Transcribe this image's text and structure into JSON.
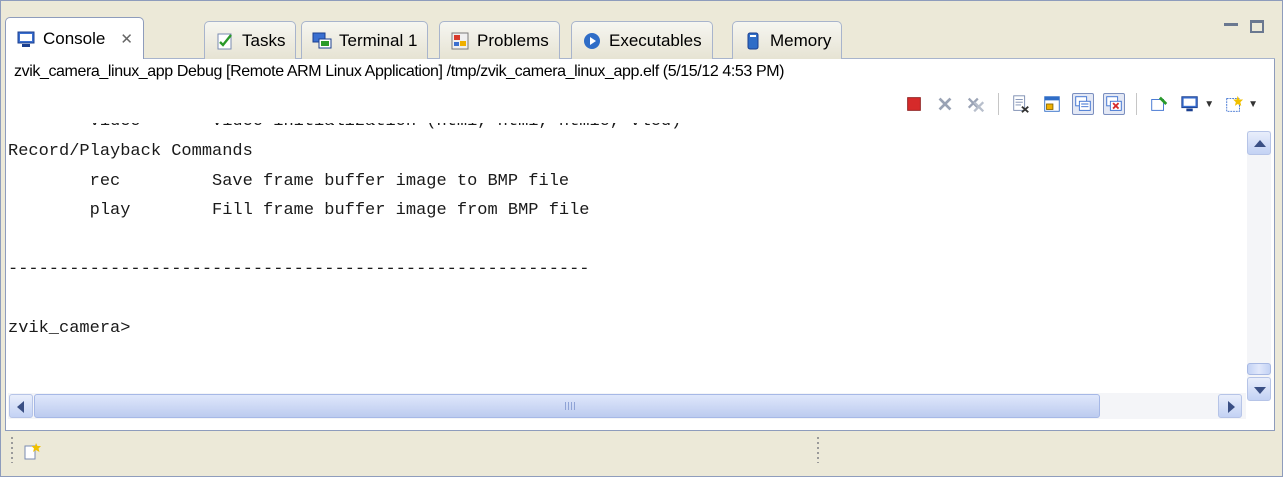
{
  "tabs": [
    {
      "label": "Console",
      "icon": "console-icon",
      "active": true,
      "close": "✕"
    },
    {
      "label": "Tasks",
      "icon": "tasks-icon"
    },
    {
      "label": "Terminal 1",
      "icon": "terminal-icon"
    },
    {
      "label": "Problems",
      "icon": "problems-icon"
    },
    {
      "label": "Executables",
      "icon": "executables-icon"
    },
    {
      "label": "Memory",
      "icon": "memory-icon"
    }
  ],
  "console": {
    "description": "zvik_camera_linux_app Debug [Remote ARM Linux Application] /tmp/zvik_camera_linux_app.elf (5/15/12 4:53 PM)",
    "partial_line": "        video       Video initialization (ntmi, ntmi, ntmio, vlcd)",
    "lines": [
      "Record/Playback Commands",
      "        rec         Save frame buffer image to BMP file",
      "        play        Fill frame buffer image from BMP file",
      "",
      "---------------------------------------------------------",
      "",
      "zvik_camera>"
    ]
  },
  "toolbar": {
    "icons": [
      "terminate-icon",
      "remove-launch-icon",
      "remove-all-icon",
      "clear-console-icon",
      "scroll-lock-icon",
      "show-on-stdout-icon",
      "show-on-stderr-icon",
      "pin-console-icon",
      "display-console-icon",
      "open-console-icon"
    ]
  },
  "colors": {
    "accent": "#316ac5",
    "terminate": "#d62a2a",
    "tab_border": "#8e9cbc"
  }
}
